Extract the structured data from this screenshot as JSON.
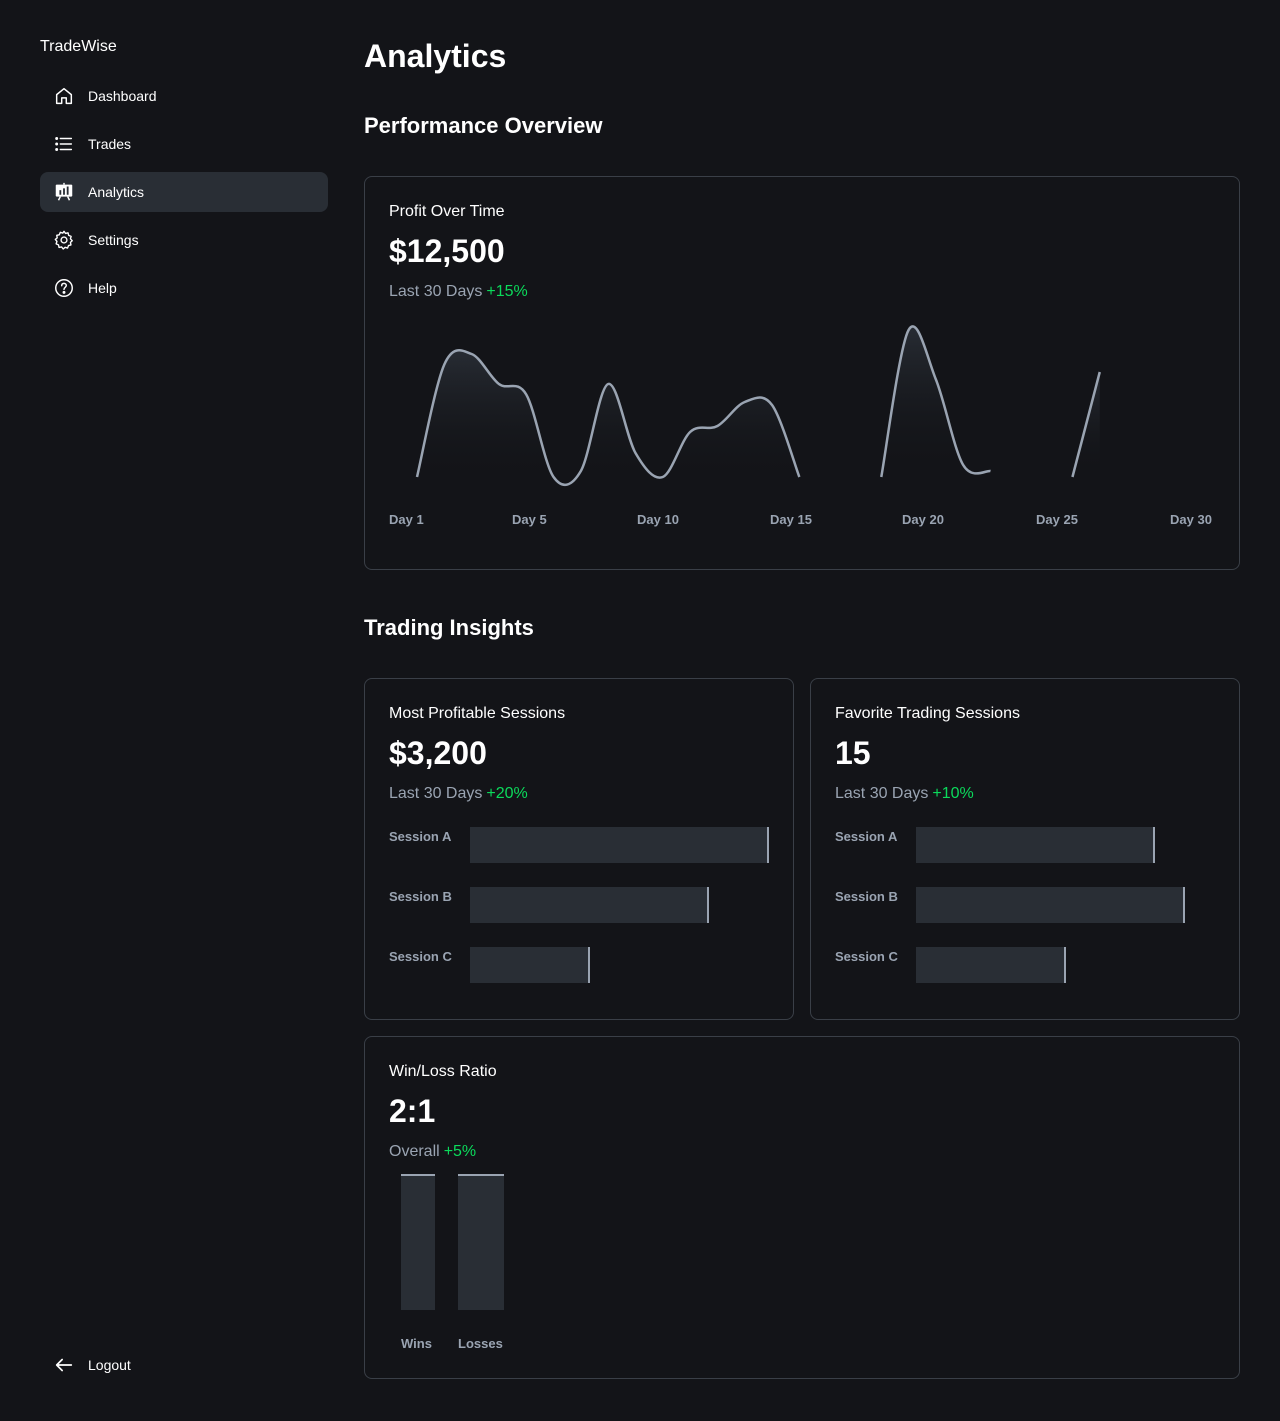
{
  "app": {
    "name": "TradeWise"
  },
  "sidebar": {
    "items": [
      {
        "label": "Dashboard",
        "icon": "house-icon",
        "active": false
      },
      {
        "label": "Trades",
        "icon": "list-icon",
        "active": false
      },
      {
        "label": "Analytics",
        "icon": "presentation-chart-icon",
        "active": true
      },
      {
        "label": "Settings",
        "icon": "gear-icon",
        "active": false
      },
      {
        "label": "Help",
        "icon": "question-circle-icon",
        "active": false
      }
    ],
    "logout": {
      "label": "Logout",
      "icon": "arrow-left-icon"
    }
  },
  "page": {
    "title": "Analytics",
    "performance_heading": "Performance Overview",
    "insights_heading": "Trading Insights"
  },
  "profit_card": {
    "title": "Profit Over Time",
    "value": "$12,500",
    "period": "Last 30 Days",
    "delta": "+15%"
  },
  "sessions_profit_card": {
    "title": "Most Profitable Sessions",
    "value": "$3,200",
    "period": "Last 30 Days",
    "delta": "+20%"
  },
  "sessions_fav_card": {
    "title": "Favorite Trading Sessions",
    "value": "15",
    "period": "Last 30 Days",
    "delta": "+10%"
  },
  "winloss_card": {
    "title": "Win/Loss Ratio",
    "value": "2:1",
    "period": "Overall",
    "delta": "+5%"
  },
  "colors": {
    "background": "#131418",
    "surface": "#292e35",
    "border": "#3a3f47",
    "muted_text": "#9aa4b2",
    "positive": "#0bda5b",
    "line": "#9aa4b2"
  },
  "chart_data": [
    {
      "type": "line",
      "x_labels": [
        "Day 1",
        "Day 5",
        "Day 10",
        "Day 15",
        "Day 20",
        "Day 25",
        "Day 30"
      ],
      "x": [
        1,
        2,
        3,
        4,
        5,
        6,
        7,
        8,
        9,
        10,
        11,
        12,
        13,
        14,
        15,
        16,
        17,
        18,
        19,
        20,
        21,
        22,
        23,
        24,
        25,
        26,
        27,
        28,
        29,
        30
      ],
      "y": [
        0,
        0.75,
        0.82,
        0.62,
        0.55,
        0,
        0.04,
        0.62,
        0.16,
        0,
        0.3,
        0.34,
        0.5,
        0.48,
        0,
        null,
        null,
        0,
        0.98,
        0.65,
        0.08,
        0.04,
        null,
        null,
        0,
        0.7,
        null,
        null,
        null,
        null
      ],
      "title": "",
      "xlabel": "",
      "ylabel": "",
      "ylim": [
        0,
        1
      ],
      "grid": false,
      "fill": "gradient"
    },
    {
      "type": "bar",
      "orientation": "horizontal",
      "categories": [
        "Session A",
        "Session B",
        "Session C"
      ],
      "values": [
        100,
        80,
        40
      ],
      "title": "",
      "xlabel": "",
      "ylabel": "",
      "xlim": [
        0,
        100
      ]
    },
    {
      "type": "bar",
      "orientation": "horizontal",
      "categories": [
        "Session A",
        "Session B",
        "Session C"
      ],
      "values": [
        80,
        90,
        50
      ],
      "title": "",
      "xlabel": "",
      "ylabel": "",
      "xlim": [
        0,
        100
      ]
    },
    {
      "type": "bar",
      "orientation": "vertical",
      "categories": [
        "Wins",
        "Losses"
      ],
      "values": [
        100,
        100
      ],
      "title": "",
      "xlabel": "",
      "ylabel": "",
      "ylim": [
        0,
        100
      ]
    }
  ]
}
